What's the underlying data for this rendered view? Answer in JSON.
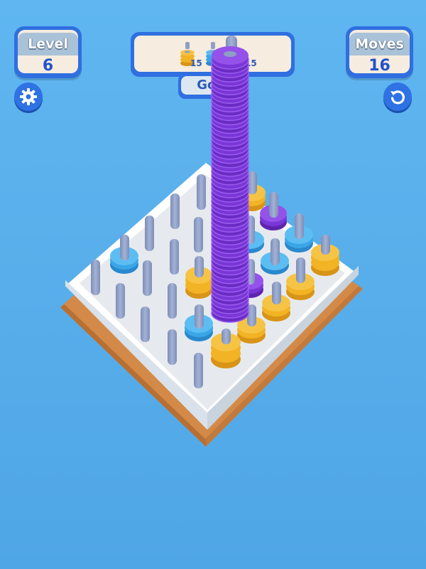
{
  "level": {
    "label": "Level",
    "value": "6"
  },
  "moves": {
    "label": "Moves",
    "value": "16"
  },
  "goal": {
    "label": "Goal",
    "items": [
      {
        "color": "#f2b324",
        "count": "15"
      },
      {
        "color": "#3aa6e8",
        "count": "15"
      }
    ]
  },
  "icons": {
    "settings": "gear-icon",
    "restart": "restart-icon"
  },
  "colors": {
    "panel_border": "#2f6fe0",
    "panel_fill": "#f6ecdf",
    "ring_yellow": "#f2b324",
    "ring_blue": "#3aa6e8",
    "ring_purple": "#7a36d6",
    "peg": "#8f9fc4",
    "board": "#ecf0f4",
    "board_base": "#d38a48"
  },
  "board": {
    "pegs": [
      {
        "ring": "none",
        "count": 0
      },
      {
        "ring": "purple",
        "count": 60
      },
      {
        "ring": "yellow",
        "count": 3
      },
      {
        "ring": "purple",
        "count": 2
      },
      {
        "ring": "blue",
        "count": 2
      },
      {
        "ring": "yellow",
        "count": 3
      },
      {
        "ring": "blue",
        "count": 3
      },
      {
        "ring": "yellow",
        "count": 3
      },
      {
        "ring": "purple",
        "count": 2
      },
      {
        "ring": "yellow",
        "count": 3
      },
      {
        "ring": "yellow",
        "count": 3
      },
      {
        "ring": "yellow",
        "count": 3
      },
      {
        "ring": "blue",
        "count": 2
      },
      {
        "ring": "blue",
        "count": 3
      },
      {
        "ring": "yellow",
        "count": 3
      }
    ]
  }
}
